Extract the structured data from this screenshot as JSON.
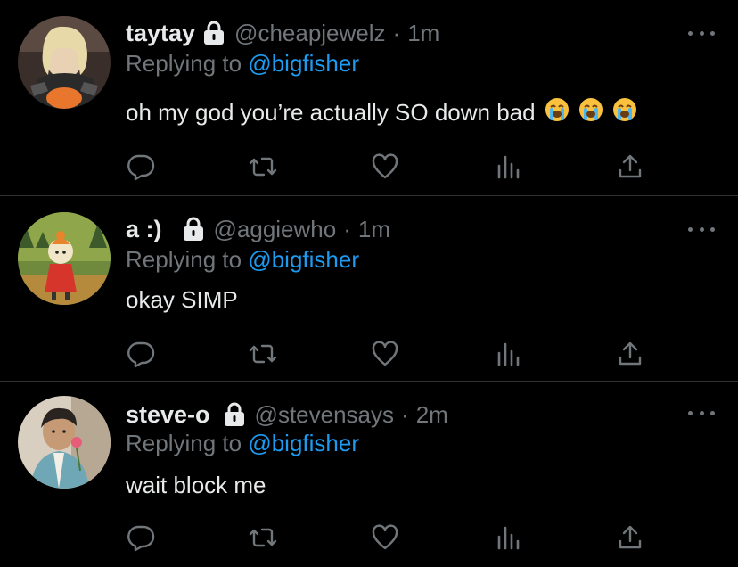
{
  "tweets": [
    {
      "display_name": "taytay",
      "handle": "@cheapjewelz",
      "separator": "·",
      "time": "1m",
      "replying_prefix": "Replying to",
      "replying_to": "@bigfisher",
      "text": "oh my god you’re actually SO down bad",
      "emojis": [
        "loudly-crying-face",
        "loudly-crying-face",
        "loudly-crying-face"
      ]
    },
    {
      "display_name": "a :)",
      "handle": "@aggiewho",
      "separator": "·",
      "time": "1m",
      "replying_prefix": "Replying to",
      "replying_to": "@bigfisher",
      "text": "okay SIMP",
      "emojis": []
    },
    {
      "display_name": "steve-o",
      "handle": "@stevensays",
      "separator": "·",
      "time": "2m",
      "replying_prefix": "Replying to",
      "replying_to": "@bigfisher",
      "text": "wait block me",
      "emojis": []
    }
  ],
  "icons": {
    "lock": "lock-icon",
    "more": "more-icon",
    "reply": "reply-icon",
    "retweet": "retweet-icon",
    "like": "heart-icon",
    "views": "analytics-icon",
    "share": "share-icon"
  },
  "colors": {
    "background": "#000000",
    "primary_text": "#e7e9ea",
    "secondary_text": "#71767b",
    "mention": "#1d9bf0",
    "divider": "#2f3336"
  }
}
